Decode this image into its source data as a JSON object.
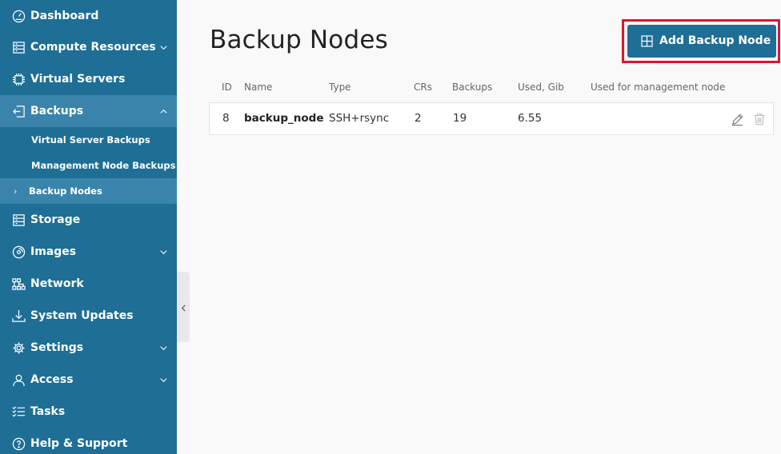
{
  "sidebar": {
    "items": [
      {
        "label": "Dashboard",
        "icon": "dashboard-icon"
      },
      {
        "label": "Compute Resources",
        "icon": "compute-icon",
        "expandable": true
      },
      {
        "label": "Virtual Servers",
        "icon": "virtual-servers-icon"
      },
      {
        "label": "Backups",
        "icon": "backups-icon",
        "expanded": true
      },
      {
        "label": "Storage",
        "icon": "storage-icon"
      },
      {
        "label": "Images",
        "icon": "images-icon",
        "expandable": true
      },
      {
        "label": "Network",
        "icon": "network-icon"
      },
      {
        "label": "System Updates",
        "icon": "download-icon"
      },
      {
        "label": "Settings",
        "icon": "gear-icon",
        "expandable": true
      },
      {
        "label": "Access",
        "icon": "user-icon",
        "expandable": true
      },
      {
        "label": "Tasks",
        "icon": "tasks-icon"
      },
      {
        "label": "Help & Support",
        "icon": "help-icon"
      }
    ],
    "backups_sub": [
      {
        "label": "Virtual Server Backups"
      },
      {
        "label": "Management Node Backups"
      },
      {
        "label": "Backup Nodes",
        "current": true
      }
    ]
  },
  "main": {
    "title": "Backup Nodes",
    "add_button_label": "Add Backup Node",
    "table": {
      "columns": [
        "ID",
        "Name",
        "Type",
        "CRs",
        "Backups",
        "Used, Gib",
        "Used for management node"
      ],
      "rows": [
        {
          "id": "8",
          "name": "backup_node",
          "type": "SSH+rsync",
          "crs": "2",
          "backups": "19",
          "used_gib": "6.55",
          "used_for_mgmt": ""
        }
      ]
    }
  },
  "colors": {
    "sidebar_bg": "#1e6e96",
    "sidebar_active": "#3a84ab",
    "accent_button": "#1e6e96",
    "highlight": "#e0142c"
  }
}
